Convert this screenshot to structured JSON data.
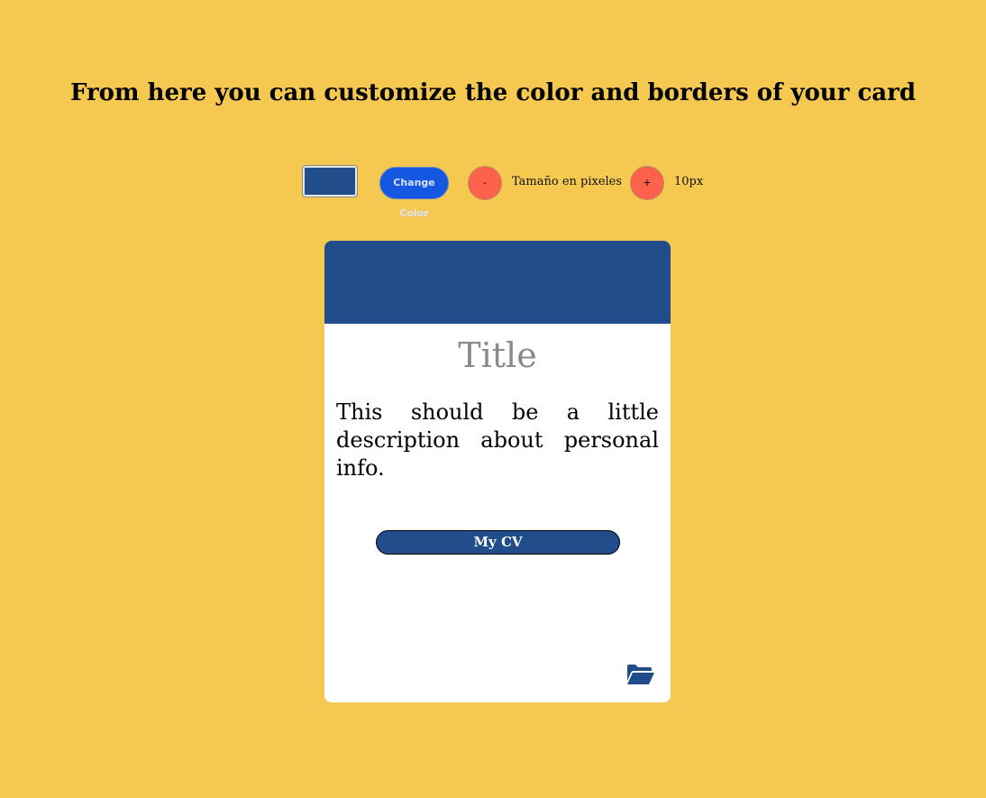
{
  "heading": "From here you can customize the color and borders of your card",
  "controls": {
    "color_value": "#214e8b",
    "change_color_label": "Change Color",
    "minus_label": "-",
    "size_label": "Tamaño en pixeles",
    "plus_label": "+",
    "size_value": "10px"
  },
  "card": {
    "header_color": "#214e8b",
    "title": "Title",
    "description": "This should be a little description about personal info.",
    "cv_button_label": "My CV",
    "footer_icon": "folder-open-icon"
  },
  "colors": {
    "background": "#f5c84f",
    "accent": "#214e8b",
    "change_button": "#1457e0",
    "round_button": "#ff624c"
  }
}
